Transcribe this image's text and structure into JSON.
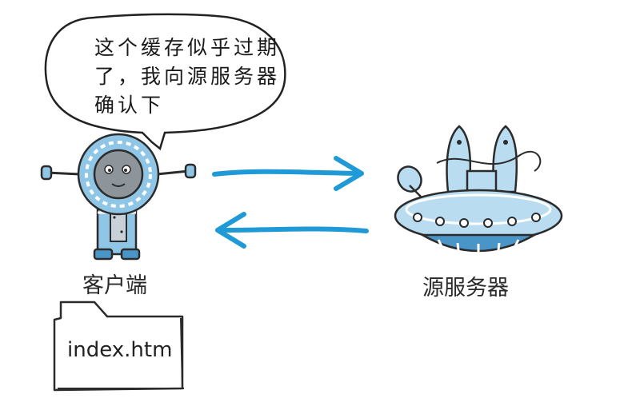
{
  "speech_bubble": {
    "lines": [
      "这个缓存似乎过期",
      "了，我向源服务器",
      "确认下"
    ]
  },
  "client": {
    "label": "客户端"
  },
  "server": {
    "label": "源服务器"
  },
  "file": {
    "name": "index.htm"
  },
  "colors": {
    "arrow": "#1f9ad6",
    "robot_body": "#8fc6e6",
    "robot_dark": "#4a95c8",
    "robot_face": "#8d949a",
    "ufo_body": "#b9dcf0",
    "outline": "#2b2b2b"
  }
}
